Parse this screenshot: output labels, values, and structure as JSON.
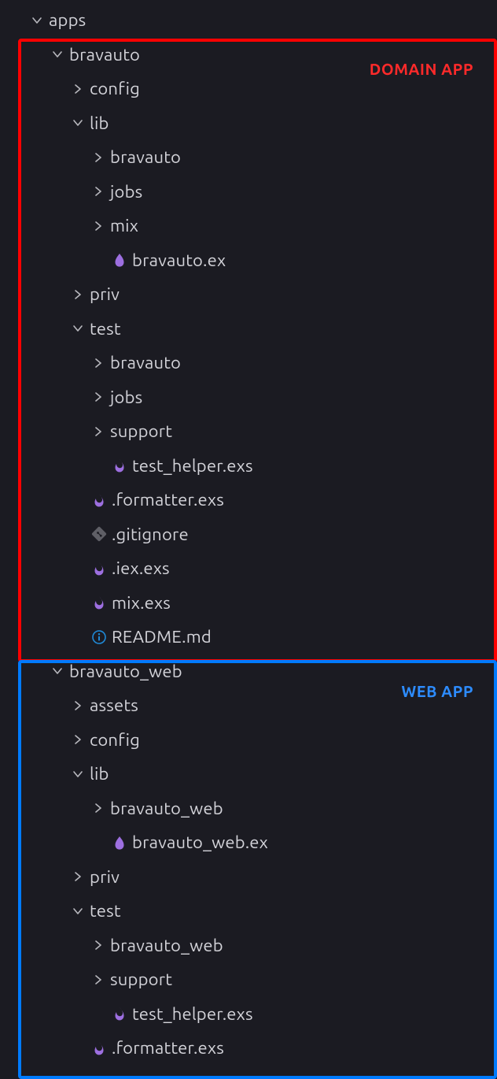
{
  "colors": {
    "bg": "#1b1b22",
    "text": "#cfcfd4",
    "chevron": "#a9a9b0",
    "elixir_drop": "#9d6fe0",
    "elixir_script": "#a06ee1",
    "git": "#5f5f66",
    "info": "#1f8ad8",
    "red": "#ff0000",
    "blue": "#007bff"
  },
  "annotations": {
    "domain": "DOMAIN APP",
    "web": "WEB APP"
  },
  "rows": [
    {
      "depth": 0,
      "chevron": "down",
      "icon": "none",
      "label": "apps"
    },
    {
      "depth": 1,
      "chevron": "down",
      "icon": "none",
      "label": "bravauto"
    },
    {
      "depth": 2,
      "chevron": "right",
      "icon": "none",
      "label": "config"
    },
    {
      "depth": 2,
      "chevron": "down",
      "icon": "none",
      "label": "lib"
    },
    {
      "depth": 3,
      "chevron": "right",
      "icon": "none",
      "label": "bravauto"
    },
    {
      "depth": 3,
      "chevron": "right",
      "icon": "none",
      "label": "jobs"
    },
    {
      "depth": 3,
      "chevron": "right",
      "icon": "none",
      "label": "mix"
    },
    {
      "depth": 3,
      "chevron": "",
      "icon": "elixir-drop",
      "label": "bravauto.ex"
    },
    {
      "depth": 2,
      "chevron": "right",
      "icon": "none",
      "label": "priv"
    },
    {
      "depth": 2,
      "chevron": "down",
      "icon": "none",
      "label": "test"
    },
    {
      "depth": 3,
      "chevron": "right",
      "icon": "none",
      "label": "bravauto"
    },
    {
      "depth": 3,
      "chevron": "right",
      "icon": "none",
      "label": "jobs"
    },
    {
      "depth": 3,
      "chevron": "right",
      "icon": "none",
      "label": "support"
    },
    {
      "depth": 3,
      "chevron": "",
      "icon": "elixir-script",
      "label": "test_helper.exs"
    },
    {
      "depth": 2,
      "chevron": "",
      "icon": "elixir-script",
      "label": ".formatter.exs"
    },
    {
      "depth": 2,
      "chevron": "",
      "icon": "git",
      "label": ".gitignore"
    },
    {
      "depth": 2,
      "chevron": "",
      "icon": "elixir-script",
      "label": ".iex.exs"
    },
    {
      "depth": 2,
      "chevron": "",
      "icon": "elixir-script",
      "label": "mix.exs"
    },
    {
      "depth": 2,
      "chevron": "",
      "icon": "info",
      "label": "README.md"
    },
    {
      "depth": 1,
      "chevron": "down",
      "icon": "none",
      "label": "bravauto_web"
    },
    {
      "depth": 2,
      "chevron": "right",
      "icon": "none",
      "label": "assets"
    },
    {
      "depth": 2,
      "chevron": "right",
      "icon": "none",
      "label": "config"
    },
    {
      "depth": 2,
      "chevron": "down",
      "icon": "none",
      "label": "lib"
    },
    {
      "depth": 3,
      "chevron": "right",
      "icon": "none",
      "label": "bravauto_web"
    },
    {
      "depth": 3,
      "chevron": "",
      "icon": "elixir-drop",
      "label": "bravauto_web.ex"
    },
    {
      "depth": 2,
      "chevron": "right",
      "icon": "none",
      "label": "priv"
    },
    {
      "depth": 2,
      "chevron": "down",
      "icon": "none",
      "label": "test"
    },
    {
      "depth": 3,
      "chevron": "right",
      "icon": "none",
      "label": "bravauto_web"
    },
    {
      "depth": 3,
      "chevron": "right",
      "icon": "none",
      "label": "support"
    },
    {
      "depth": 3,
      "chevron": "",
      "icon": "elixir-script",
      "label": "test_helper.exs"
    },
    {
      "depth": 2,
      "chevron": "",
      "icon": "elixir-script",
      "label": ".formatter.exs"
    }
  ]
}
